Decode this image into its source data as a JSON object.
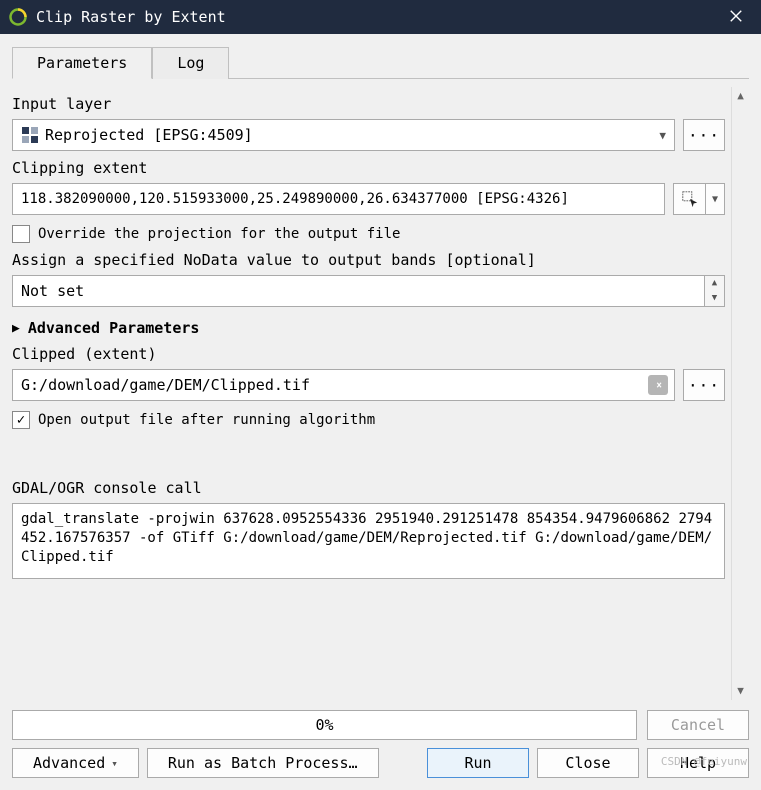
{
  "window": {
    "title": "Clip Raster by Extent",
    "close_icon": "close-icon"
  },
  "tabs": {
    "parameters": "Parameters",
    "log": "Log"
  },
  "input_layer": {
    "label": "Input layer",
    "value": "Reprojected [EPSG:4509]",
    "more": "···"
  },
  "clipping_extent": {
    "label": "Clipping extent",
    "value": "118.382090000,120.515933000,25.249890000,26.634377000 [EPSG:4326]"
  },
  "override_proj": {
    "checked": false,
    "label": "Override the projection for the output file"
  },
  "nodata": {
    "label": "Assign a specified NoData value to output bands [optional]",
    "value": "Not set"
  },
  "advanced": {
    "label": "Advanced Parameters"
  },
  "clipped": {
    "label": "Clipped (extent)",
    "value": "G:/download/game/DEM/Clipped.tif",
    "more": "···"
  },
  "open_after": {
    "checked": true,
    "label": "Open output file after running algorithm"
  },
  "console": {
    "label": "GDAL/OGR console call",
    "text": "gdal_translate -projwin 637628.0952554336 2951940.291251478 854354.9479606862 2794452.167576357 -of GTiff G:/download/game/DEM/Reprojected.tif G:/download/game/DEM/Clipped.tif"
  },
  "progress": {
    "text": "0%"
  },
  "buttons": {
    "cancel": "Cancel",
    "advanced": "Advanced",
    "batch": "Run as Batch Process…",
    "run": "Run",
    "close": "Close",
    "help": "Help"
  },
  "watermark": "CSDN @feiyunw"
}
